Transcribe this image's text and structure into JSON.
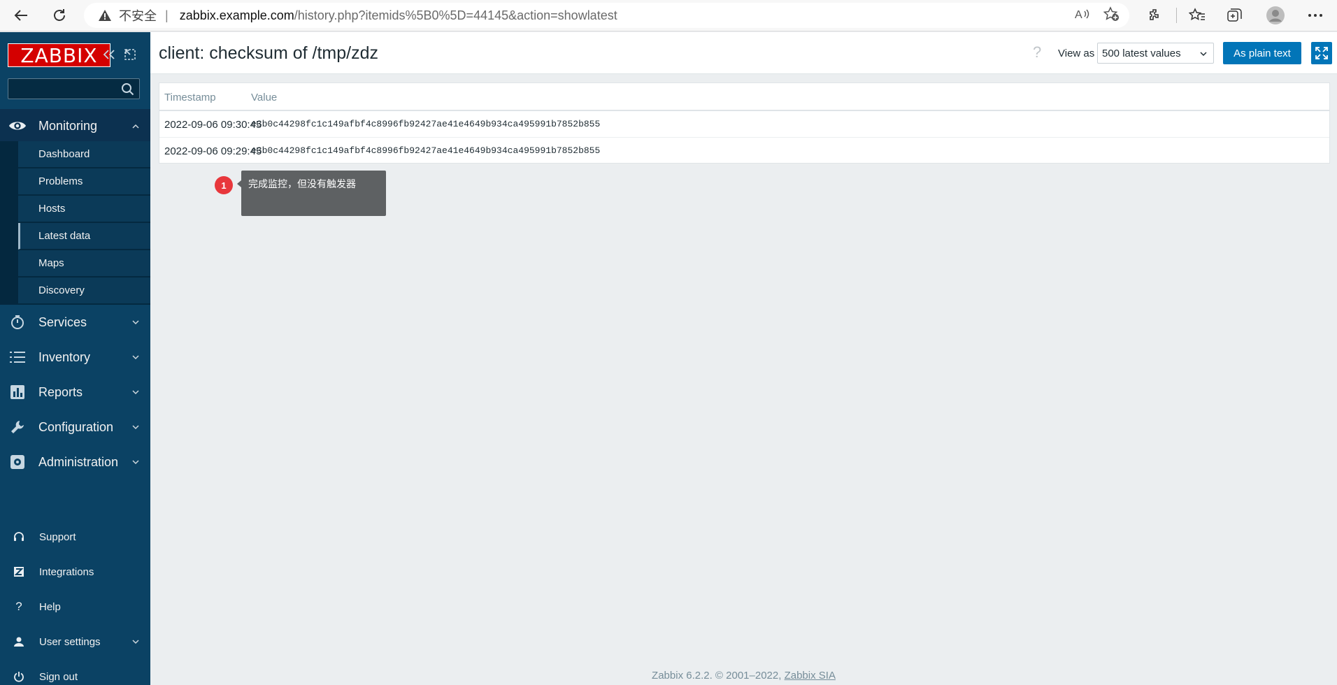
{
  "browser": {
    "insecure_label": "不安全",
    "url_host": "zabbix.example.com",
    "url_path": "/history.php?itemids%5B0%5D=44145&action=showlatest"
  },
  "sidebar": {
    "logo": "ZABBIX",
    "search_placeholder": "",
    "monitoring": {
      "label": "Monitoring"
    },
    "submenu": [
      "Dashboard",
      "Problems",
      "Hosts",
      "Latest data",
      "Maps",
      "Discovery"
    ],
    "active_submenu": "Latest data",
    "menu": [
      "Services",
      "Inventory",
      "Reports",
      "Configuration",
      "Administration"
    ],
    "bottom": [
      "Support",
      "Integrations",
      "Help",
      "User settings",
      "Sign out"
    ]
  },
  "header": {
    "title": "client: checksum of /tmp/zdz",
    "help": "?",
    "view_as_label": "View as",
    "view_select_value": "500 latest values",
    "plain_text_button": "As plain text"
  },
  "table": {
    "columns": [
      "Timestamp",
      "Value"
    ],
    "rows": [
      {
        "timestamp": "2022-09-06 09:30:45",
        "value": "e3b0c44298fc1c149afbf4c8996fb92427ae41e4649b934ca495991b7852b855"
      },
      {
        "timestamp": "2022-09-06 09:29:45",
        "value": "e3b0c44298fc1c149afbf4c8996fb92427ae41e4649b934ca495991b7852b855"
      }
    ]
  },
  "annotation": {
    "badge": "1",
    "text": "完成监控，但没有触发器"
  },
  "footer": {
    "text": "Zabbix 6.2.2. © 2001–2022,",
    "link": "Zabbix SIA"
  },
  "colors": {
    "sidebar_bg": "#0b4264",
    "brand_red": "#d40000",
    "primary_button": "#0275b8",
    "badge_red": "#e8373c"
  }
}
